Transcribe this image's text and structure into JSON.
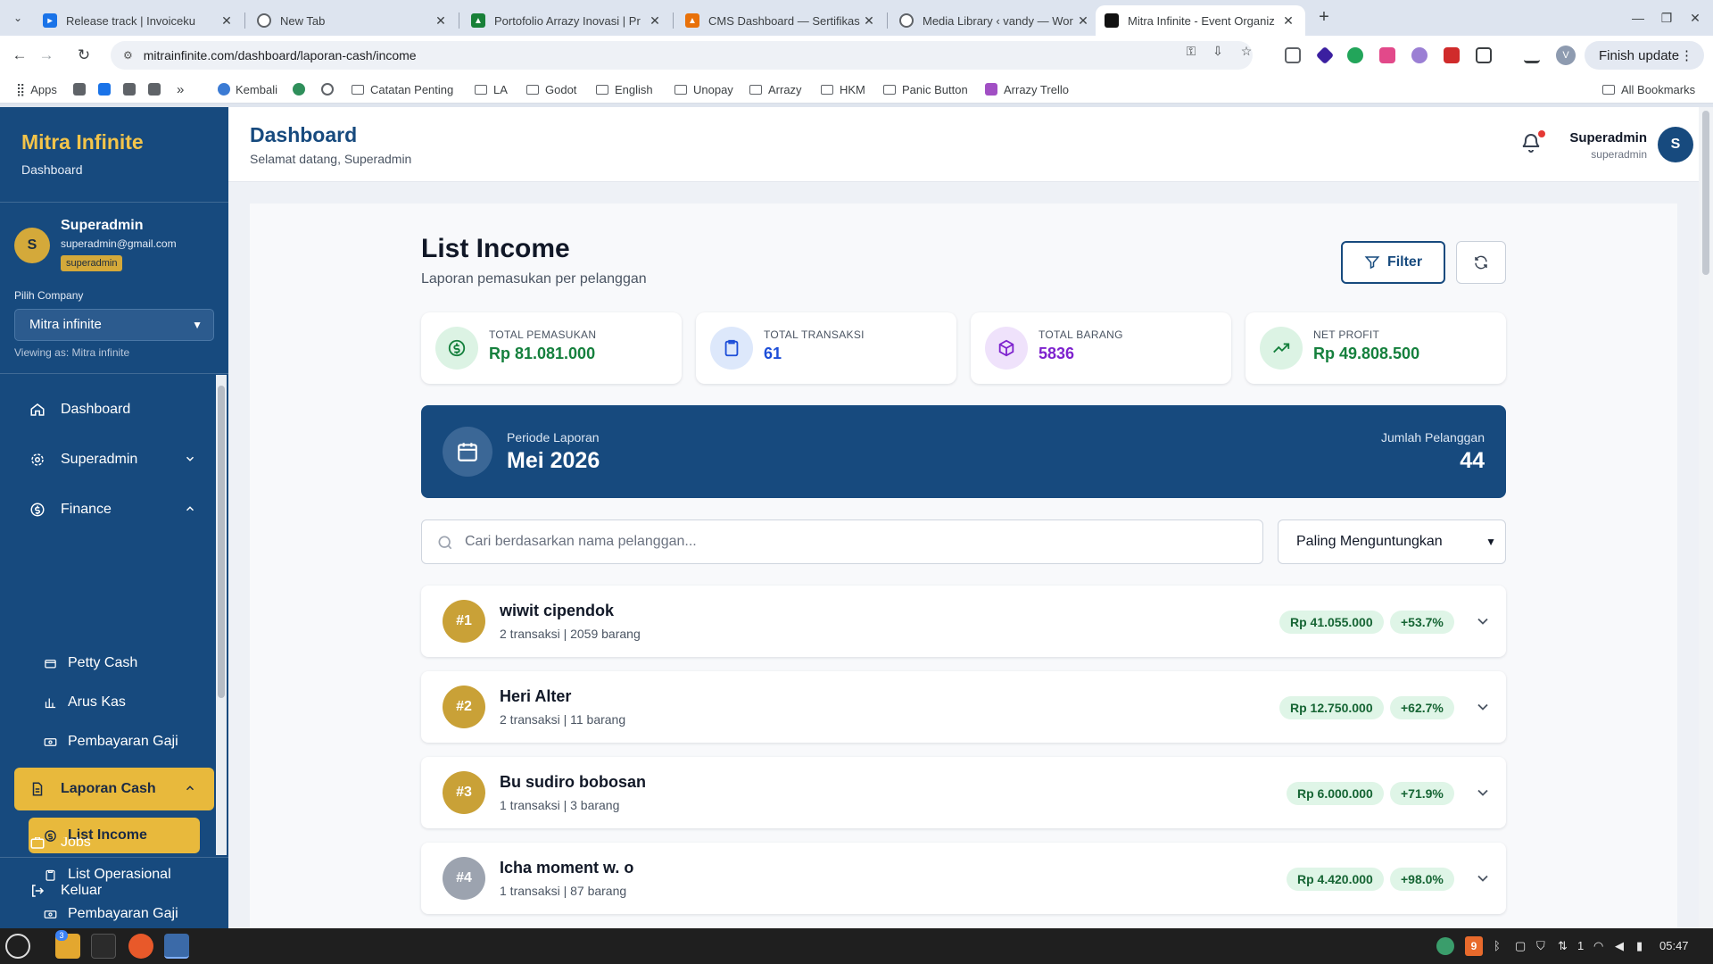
{
  "browser": {
    "tabs": [
      {
        "title": "Release track | Invoiceku",
        "icon": "invoiceku-icon",
        "color": "#1a73e8"
      },
      {
        "title": "New Tab",
        "icon": "chrome-icon",
        "color": "#5f6368"
      },
      {
        "title": "Portofolio Arrazy Inovasi | Pr",
        "icon": "drive-icon",
        "color": "#188038"
      },
      {
        "title": "CMS Dashboard — Sertifikas",
        "icon": "cms-icon",
        "color": "#e8710a"
      },
      {
        "title": "Media Library ‹ vandy — Wor",
        "icon": "wordpress-icon",
        "color": "#5f6368"
      },
      {
        "title": "Mitra Infinite - Event Organiz",
        "icon": "mitra-icon",
        "color": "#111111"
      }
    ],
    "url": "mitrainfinite.com/dashboard/laporan-cash/income",
    "finish_update": "Finish update",
    "profile_initial": "V",
    "bookmarks": [
      {
        "label": "Apps",
        "icon": "apps-icon"
      },
      {
        "label": "Kembali",
        "icon": "bookmark-icon"
      },
      {
        "label": "Catatan Penting",
        "icon": "folder-icon"
      },
      {
        "label": "LA",
        "icon": "folder-icon"
      },
      {
        "label": "Godot",
        "icon": "folder-icon"
      },
      {
        "label": "English",
        "icon": "folder-icon"
      },
      {
        "label": "Unopay",
        "icon": "folder-icon"
      },
      {
        "label": "Arrazy",
        "icon": "folder-icon"
      },
      {
        "label": "HKM",
        "icon": "folder-icon"
      },
      {
        "label": "Panic Button",
        "icon": "folder-icon"
      },
      {
        "label": "Arrazy Trello",
        "icon": "trello-icon"
      }
    ],
    "all_bookmarks": "All Bookmarks"
  },
  "sidebar": {
    "brand": "Mitra Infinite",
    "brand_sub": "Dashboard",
    "user": {
      "initial": "S",
      "name": "Superadmin",
      "email": "superadmin@gmail.com",
      "role": "superadmin"
    },
    "company_label": "Pilih Company",
    "company_value": "Mitra infinite",
    "viewing": "Viewing as: Mitra infinite",
    "nav": {
      "dashboard": "Dashboard",
      "superadmin": "Superadmin",
      "finance": "Finance",
      "petty_cash": "Petty Cash",
      "arus_kas": "Arus Kas",
      "pembayaran_gaji": "Pembayaran Gaji",
      "laporan_cash": "Laporan Cash",
      "list_income": "List Income",
      "list_operasional": "List Operasional",
      "pembayaran_gaji_2": "Pembayaran Gaji",
      "jobs": "Jobs",
      "keluar": "Keluar"
    }
  },
  "header": {
    "title": "Dashboard",
    "subtitle": "Selamat datang, Superadmin",
    "user_name": "Superadmin",
    "user_role": "superadmin",
    "avatar_initial": "S"
  },
  "main": {
    "title": "List Income",
    "subtitle": "Laporan pemasukan per pelanggan",
    "filter_label": "Filter",
    "stats": [
      {
        "label": "TOTAL PEMASUKAN",
        "value": "Rp 81.081.000",
        "icon": "dollar-icon",
        "color": "#15803d",
        "bg": "#dcf3e4"
      },
      {
        "label": "TOTAL TRANSAKSI",
        "value": "61",
        "icon": "clipboard-icon",
        "color": "#1d4ed8",
        "bg": "#dde8fb"
      },
      {
        "label": "TOTAL BARANG",
        "value": "5836",
        "icon": "box-icon",
        "color": "#7e22ce",
        "bg": "#efe2fb"
      },
      {
        "label": "NET PROFIT",
        "value": "Rp 49.808.500",
        "icon": "trending-up-icon",
        "color": "#15803d",
        "bg": "#dcf3e4"
      }
    ],
    "periode": {
      "label": "Periode Laporan",
      "value": "Mei 2026",
      "count_label": "Jumlah Pelanggan",
      "count": "44"
    },
    "search_placeholder": "Cari berdasarkan nama pelanggan...",
    "sort_value": "Paling Menguntungkan",
    "customers": [
      {
        "rank": "#1",
        "name": "wiwit cipendok",
        "meta": "2 transaksi | 2059 barang",
        "amount": "Rp 41.055.000",
        "margin": "+53.7%",
        "rank_color": "#c9a137"
      },
      {
        "rank": "#2",
        "name": "Heri Alter",
        "meta": "2 transaksi | 11 barang",
        "amount": "Rp 12.750.000",
        "margin": "+62.7%",
        "rank_color": "#c9a137"
      },
      {
        "rank": "#3",
        "name": "Bu sudiro bobosan",
        "meta": "1 transaksi | 3 barang",
        "amount": "Rp 6.000.000",
        "margin": "+71.9%",
        "rank_color": "#c9a137"
      },
      {
        "rank": "#4",
        "name": "Icha moment w. o",
        "meta": "1 transaksi | 87 barang",
        "amount": "Rp 4.420.000",
        "margin": "+98.0%",
        "rank_color": "#9ca3af"
      }
    ]
  },
  "taskbar": {
    "badge": "3",
    "tray_badge": "9",
    "tray_count": "1",
    "clock": "05:47"
  }
}
